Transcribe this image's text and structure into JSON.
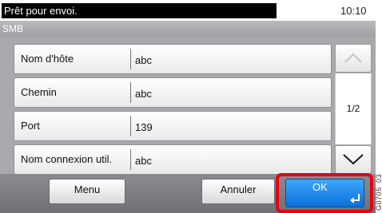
{
  "status": {
    "message": "Prêt pour envoi.",
    "time": "10:10"
  },
  "title": "SMB",
  "rows": [
    {
      "label": "Nom d'hôte",
      "value": "abc"
    },
    {
      "label": "Chemin",
      "value": "abc"
    },
    {
      "label": "Port",
      "value": "139"
    },
    {
      "label": "Nom connexion util.",
      "value": "abc"
    }
  ],
  "pagination": {
    "indicator": "1/2",
    "up_icon": "chevron-up-icon",
    "down_icon": "chevron-down-icon"
  },
  "buttons": {
    "menu": "Menu",
    "cancel": "Annuler",
    "ok": "OK"
  },
  "colors": {
    "highlight": "#e60012",
    "ok_button": "#1a86ee",
    "status_bg": "#000000"
  },
  "side_code": "G0705_03"
}
